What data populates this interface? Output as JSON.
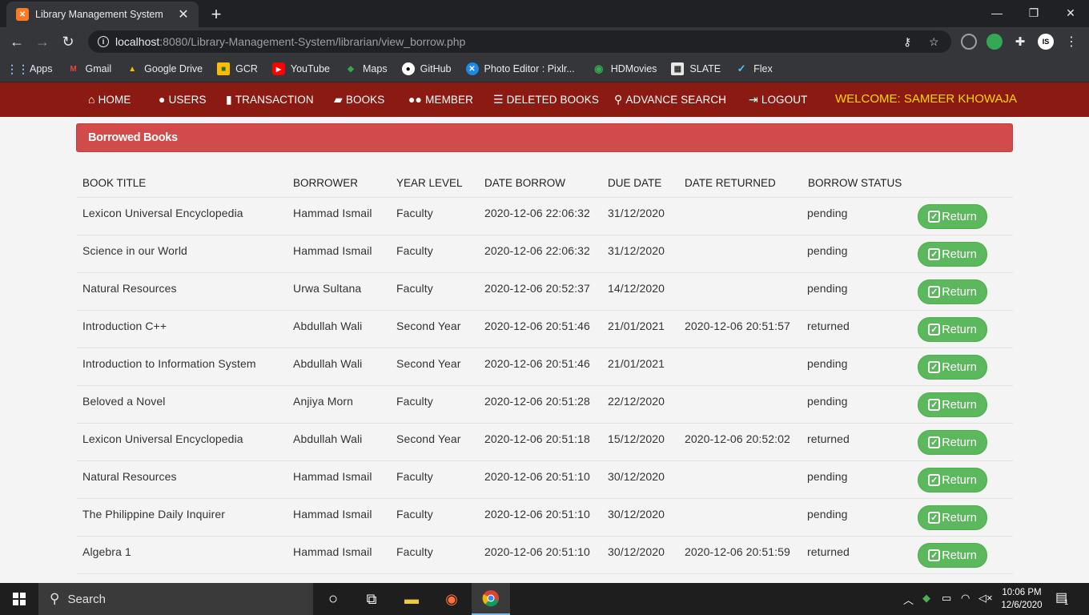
{
  "browser": {
    "tab_title": "Library Management System",
    "tab_favicon": "XAMPP",
    "url_host": "localhost",
    "url_rest": ":8080/Library-Management-System/librarian/view_borrow.php",
    "bookmarks": [
      {
        "label": "Apps",
        "icon": "apps-grid-icon"
      },
      {
        "label": "Gmail",
        "icon": "gmail-icon"
      },
      {
        "label": "Google Drive",
        "icon": "google-drive-icon"
      },
      {
        "label": "GCR",
        "icon": "google-classroom-icon"
      },
      {
        "label": "YouTube",
        "icon": "youtube-icon"
      },
      {
        "label": "Maps",
        "icon": "maps-icon"
      },
      {
        "label": "GitHub",
        "icon": "github-icon"
      },
      {
        "label": "Photo Editor : Pixlr...",
        "icon": "pixlr-icon"
      },
      {
        "label": "HDMovies",
        "icon": "hdmovies-icon"
      },
      {
        "label": "SLATE",
        "icon": "slate-icon"
      },
      {
        "label": "Flex",
        "icon": "flex-icon"
      }
    ]
  },
  "navbar": {
    "items": [
      {
        "label": "HOME",
        "icon": "home-icon"
      },
      {
        "label": "USERS",
        "icon": "user-icon"
      },
      {
        "label": "TRANSACTION",
        "icon": "file-icon"
      },
      {
        "label": "BOOKS",
        "icon": "book-icon"
      },
      {
        "label": "MEMBER",
        "icon": "users-icon"
      },
      {
        "label": "DELETED BOOKS",
        "icon": "list-icon"
      },
      {
        "label": "ADVANCE SEARCH",
        "icon": "search-icon"
      },
      {
        "label": "LOGOUT",
        "icon": "sign-out-icon"
      }
    ],
    "welcome": "WELCOME: SAMEER KHOWAJA"
  },
  "panel": {
    "title": "Borrowed Books"
  },
  "table": {
    "headers": [
      "BOOK TITLE",
      "BORROWER",
      "YEAR LEVEL",
      "DATE BORROW",
      "DUE DATE",
      "DATE RETURNED",
      "BORROW STATUS"
    ],
    "return_label": "Return",
    "rows": [
      {
        "title": "Lexicon Universal Encyclopedia",
        "borrower": "Hammad Ismail",
        "year": "Faculty",
        "date_borrow": "2020-12-06 22:06:32",
        "due": "31/12/2020",
        "returned": "",
        "status": "pending"
      },
      {
        "title": "Science in our World",
        "borrower": "Hammad Ismail",
        "year": "Faculty",
        "date_borrow": "2020-12-06 22:06:32",
        "due": "31/12/2020",
        "returned": "",
        "status": "pending"
      },
      {
        "title": "Natural Resources",
        "borrower": "Urwa Sultana",
        "year": "Faculty",
        "date_borrow": "2020-12-06 20:52:37",
        "due": "14/12/2020",
        "returned": "",
        "status": "pending"
      },
      {
        "title": "Introduction C++",
        "borrower": "Abdullah Wali",
        "year": "Second Year",
        "date_borrow": "2020-12-06 20:51:46",
        "due": "21/01/2021",
        "returned": "2020-12-06 20:51:57",
        "status": "returned"
      },
      {
        "title": "Introduction to Information System",
        "borrower": "Abdullah Wali",
        "year": "Second Year",
        "date_borrow": "2020-12-06 20:51:46",
        "due": "21/01/2021",
        "returned": "",
        "status": "pending"
      },
      {
        "title": "Beloved a Novel",
        "borrower": "Anjiya Morn",
        "year": "Faculty",
        "date_borrow": "2020-12-06 20:51:28",
        "due": "22/12/2020",
        "returned": "",
        "status": "pending"
      },
      {
        "title": "Lexicon Universal Encyclopedia",
        "borrower": "Abdullah Wali",
        "year": "Second Year",
        "date_borrow": "2020-12-06 20:51:18",
        "due": "15/12/2020",
        "returned": "2020-12-06 20:52:02",
        "status": "returned"
      },
      {
        "title": "Natural Resources",
        "borrower": "Hammad Ismail",
        "year": "Faculty",
        "date_borrow": "2020-12-06 20:51:10",
        "due": "30/12/2020",
        "returned": "",
        "status": "pending"
      },
      {
        "title": "The Philippine Daily Inquirer",
        "borrower": "Hammad Ismail",
        "year": "Faculty",
        "date_borrow": "2020-12-06 20:51:10",
        "due": "30/12/2020",
        "returned": "",
        "status": "pending"
      },
      {
        "title": "Algebra 1",
        "borrower": "Hammad Ismail",
        "year": "Faculty",
        "date_borrow": "2020-12-06 20:51:10",
        "due": "30/12/2020",
        "returned": "2020-12-06 20:51:59",
        "status": "returned"
      }
    ]
  },
  "taskbar": {
    "search_placeholder": "Search",
    "time": "10:06 PM",
    "date": "12/6/2020",
    "notification_count": "1"
  },
  "colors": {
    "navbar": "#8b1a13",
    "welcome": "#ffd600",
    "panel_header": "#d24b4b",
    "return_button": "#5cb85c"
  }
}
